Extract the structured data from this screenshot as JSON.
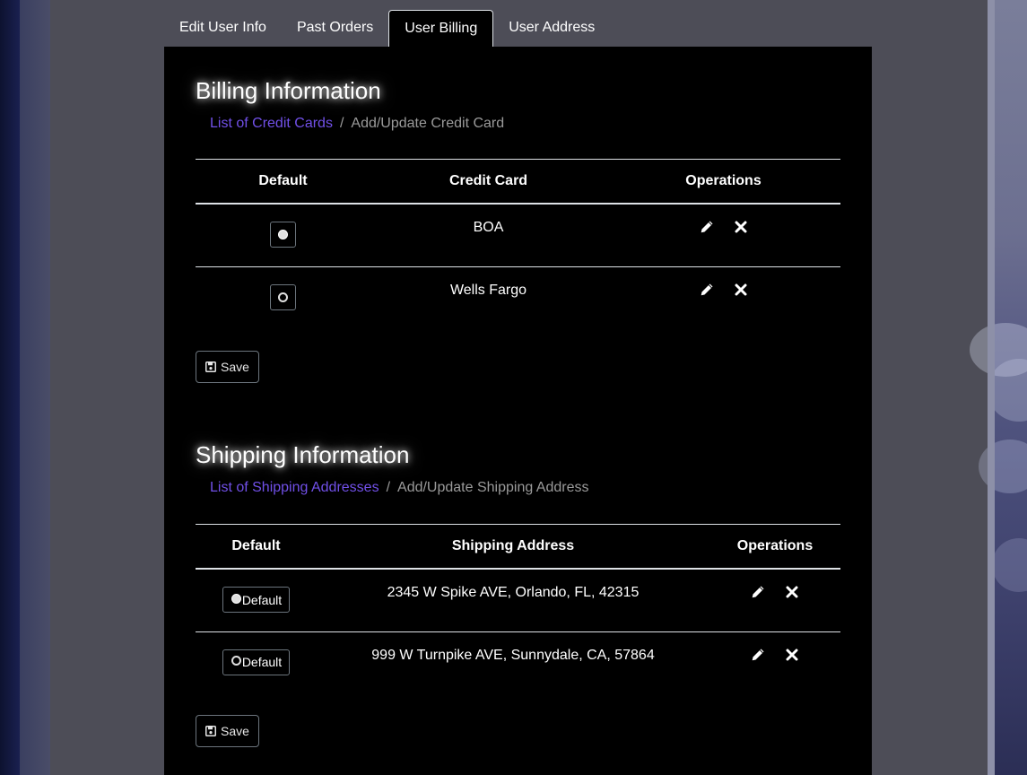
{
  "tabs": [
    {
      "label": "Edit User Info",
      "active": false
    },
    {
      "label": "Past Orders",
      "active": false
    },
    {
      "label": "User Billing",
      "active": true
    },
    {
      "label": "User Address",
      "active": false
    }
  ],
  "billing": {
    "title": "Billing Information",
    "breadcrumb": {
      "link": "List of Credit Cards",
      "separator": "/",
      "current": "Add/Update Credit Card"
    },
    "columns": [
      "Default",
      "Credit Card",
      "Operations"
    ],
    "rows": [
      {
        "card": "BOA",
        "default": true
      },
      {
        "card": "Wells Fargo",
        "default": false
      }
    ],
    "save_label": "Save"
  },
  "shipping": {
    "title": "Shipping Information",
    "breadcrumb": {
      "link": "List of Shipping Addresses",
      "separator": "/",
      "current": "Add/Update Shipping Address"
    },
    "columns": [
      "Default",
      "Shipping Address",
      "Operations"
    ],
    "rows": [
      {
        "address": "2345 W Spike AVE, Orlando, FL, 42315",
        "default": true,
        "default_label": "Default"
      },
      {
        "address": "999 W Turnpike AVE, Sunnydale, CA, 57864",
        "default": false,
        "default_label": "Default"
      }
    ],
    "save_label": "Save"
  },
  "icons": {
    "edit": "pencil-icon",
    "delete": "close-icon",
    "save": "floppy-disk-icon"
  },
  "colors": {
    "link": "#7150e8",
    "panel_bg": "#000000",
    "page_bg": "#4d4d57"
  }
}
